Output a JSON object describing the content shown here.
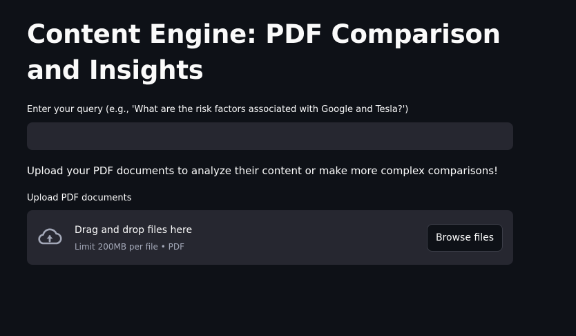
{
  "page": {
    "title": "Content Engine: PDF Comparison and Insights"
  },
  "query": {
    "label": "Enter your query (e.g., 'What are the risk factors associated with Google and Tesla?')",
    "value": "",
    "placeholder": ""
  },
  "upload": {
    "info_text": "Upload your PDF documents to analyze their content or make more complex comparisons!",
    "label": "Upload PDF documents",
    "dropzone_title": "Drag and drop files here",
    "dropzone_limit": "Limit 200MB per file • PDF",
    "browse_label": "Browse files",
    "icon": "cloud-upload-icon"
  },
  "colors": {
    "background": "#0e1117",
    "surface": "#262730",
    "text": "#fafafa",
    "muted_text": "#a3a8b8",
    "icon": "#a3a8b8"
  }
}
